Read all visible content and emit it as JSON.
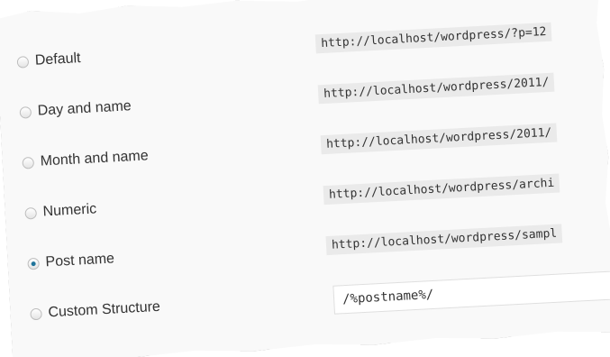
{
  "permalinks": [
    {
      "label": "Default",
      "example": "http://localhost/wordpress/?p=12",
      "checked": false
    },
    {
      "label": "Day and name",
      "example": "http://localhost/wordpress/2011/",
      "checked": false
    },
    {
      "label": "Month and name",
      "example": "http://localhost/wordpress/2011/",
      "checked": false
    },
    {
      "label": "Numeric",
      "example": "http://localhost/wordpress/archi",
      "checked": false
    },
    {
      "label": "Post name",
      "example": "http://localhost/wordpress/sampl",
      "checked": true
    }
  ],
  "custom": {
    "label": "Custom Structure",
    "value": "/%postname%/",
    "checked": false
  },
  "colors": {
    "radio_selected": "#21759b",
    "code_background": "#eaeaea"
  }
}
